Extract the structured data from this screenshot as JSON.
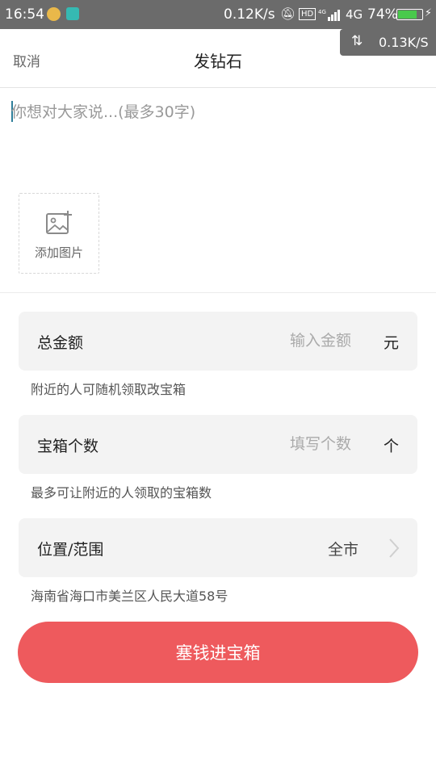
{
  "status_bar": {
    "time": "16:54",
    "net_speed": "0.12K/s",
    "hd_badge": "HD",
    "network": "4G",
    "battery": "74%",
    "battery_level": 0.74
  },
  "float_speed": {
    "value": "0.13K/S"
  },
  "nav": {
    "cancel": "取消",
    "title": "发钻石"
  },
  "message": {
    "placeholder": "你想对大家说...(最多30字)"
  },
  "add_image": {
    "label": "添加图片"
  },
  "amount": {
    "label": "总金额",
    "placeholder": "输入金额",
    "unit": "元",
    "hint": "附近的人可随机领取改宝箱"
  },
  "count": {
    "label": "宝箱个数",
    "placeholder": "填写个数",
    "unit": "个",
    "hint": "最多可让附近的人领取的宝箱数"
  },
  "location": {
    "label": "位置/范围",
    "value": "全市",
    "address": "海南省海口市美兰区人民大道58号"
  },
  "submit": {
    "label": "塞钱进宝箱"
  },
  "colors": {
    "accent": "#ee5a5d",
    "row_bg": "#f3f3f3",
    "status_bar": "#6b6b6b"
  }
}
